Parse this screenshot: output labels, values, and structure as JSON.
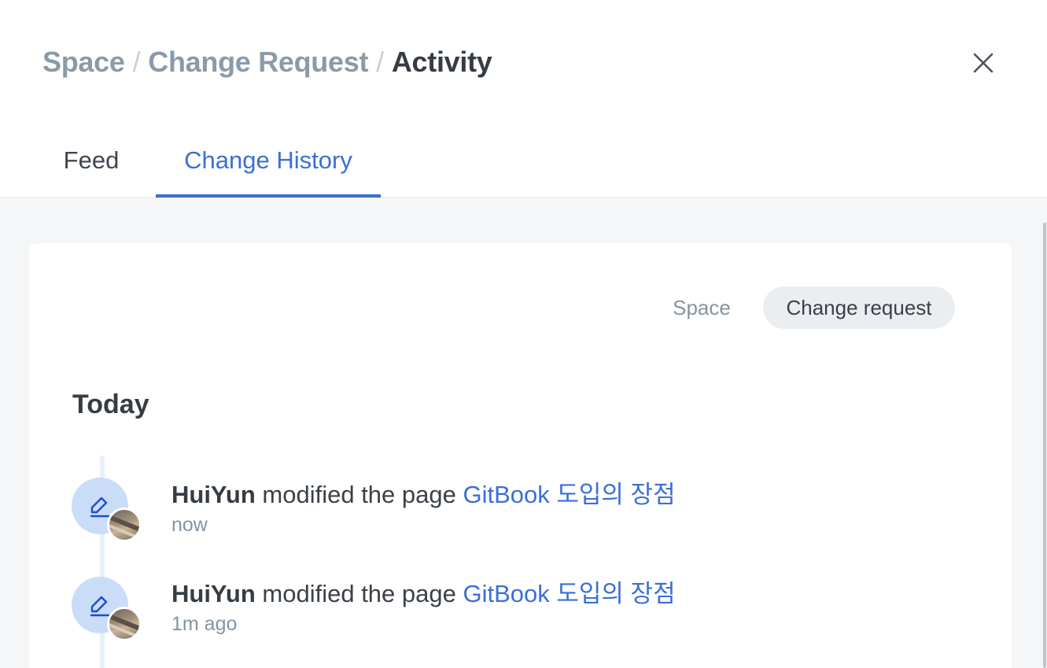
{
  "header": {
    "breadcrumb": [
      "Space",
      "Change Request"
    ],
    "current": "Activity",
    "separator": "/"
  },
  "tabs": [
    {
      "label": "Feed",
      "active": false
    },
    {
      "label": "Change History",
      "active": true
    }
  ],
  "filters": {
    "space_label": "Space",
    "change_request_label": "Change request",
    "selected": "Change request"
  },
  "section": {
    "title": "Today"
  },
  "entries": [
    {
      "user": "HuiYun",
      "action": "modified the page",
      "page": "GitBook 도입의 장점",
      "time": "now",
      "icon": "pencil-icon"
    },
    {
      "user": "HuiYun",
      "action": "modified the page",
      "page": "GitBook 도입의 장점",
      "time": "1m ago",
      "icon": "pencil-icon"
    }
  ],
  "colors": {
    "accent": "#3b6fd6",
    "icon_bg": "#c9dcf8",
    "content_bg": "#f4f6f8"
  }
}
